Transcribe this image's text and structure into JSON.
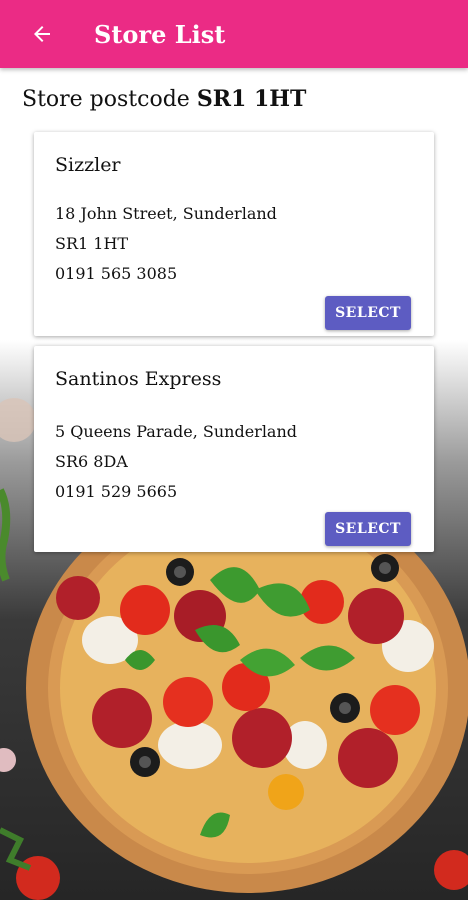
{
  "appbar": {
    "title": "Store List",
    "back_icon": "arrow-left-icon"
  },
  "postcode": {
    "label": "Store postcode",
    "value": "SR1 1HT"
  },
  "stores": [
    {
      "name": "Sizzler",
      "address": "18 John Street, Sunderland",
      "postcode": "SR1 1HT",
      "phone": "0191 565 3085",
      "button": "SELECT"
    },
    {
      "name": "Santinos Express",
      "address": "5 Queens Parade, Sunderland",
      "postcode": "SR6 8DA",
      "phone": "0191 529 5665",
      "button": "SELECT"
    }
  ],
  "colors": {
    "appbar": "#eb2b85",
    "button": "#5d5cc2"
  }
}
